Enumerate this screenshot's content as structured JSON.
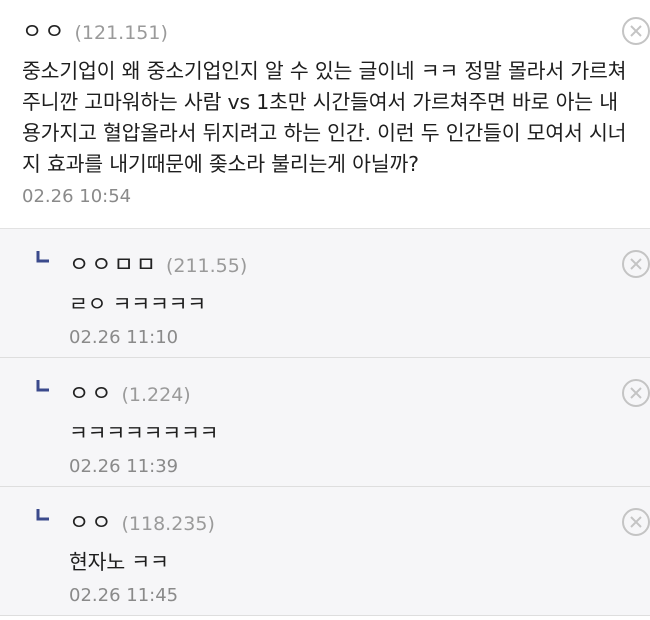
{
  "comments": [
    {
      "nick": "ㅇㅇ",
      "ip": "(121.151)",
      "text": "중소기업이 왜 중소기업인지 알 수 있는 글이네 ㅋㅋ 정말 몰라서 가르쳐주니깐 고마워하는 사람 vs 1초만 시간들여서 가르쳐주면 바로 아는 내용가지고 혈압올라서 뒤지려고 하는 인간. 이런 두 인간들이 모여서 시너지 효과를 내기때문에 좆소라 불리는게 아닐까?",
      "date": "02.26 10:54"
    }
  ],
  "replies": [
    {
      "nick": "ㅇㅇㅁㅁ",
      "ip": "(211.55)",
      "text": "ㄹㅇ ㅋㅋㅋㅋㅋ",
      "date": "02.26 11:10"
    },
    {
      "nick": "ㅇㅇ",
      "ip": "(1.224)",
      "text": "ㅋㅋㅋㅋㅋㅋㅋㅋ",
      "date": "02.26 11:39"
    },
    {
      "nick": "ㅇㅇ",
      "ip": "(118.235)",
      "text": "현자노 ㅋㅋ",
      "date": "02.26 11:45"
    }
  ],
  "icons": {
    "close": "close-circle-icon",
    "reply": "reply-arrow-icon"
  },
  "colors": {
    "reply_bg": "#f6f6f8",
    "reply_arrow": "#3b4a8c",
    "meta_gray": "#9a9a9a"
  }
}
